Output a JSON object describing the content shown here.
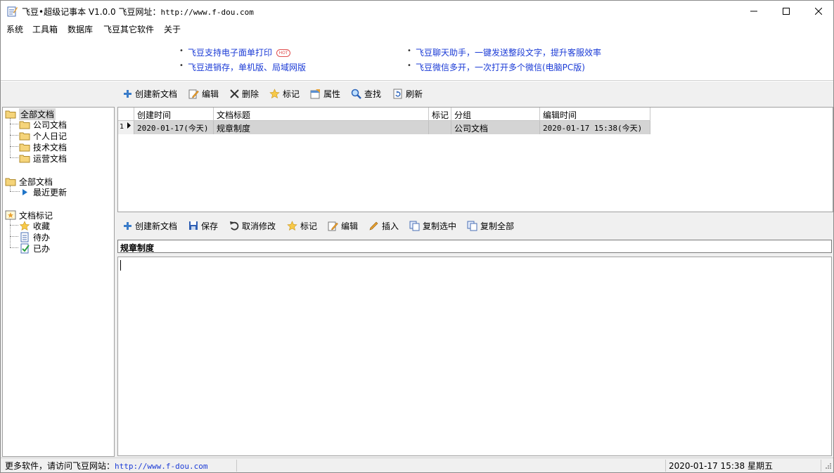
{
  "window": {
    "title": "飞豆•超级记事本 V1.0.0  飞豆网址：",
    "title_url": "http://www.f-dou.com"
  },
  "menu": [
    "系统",
    "工具箱",
    "数据库",
    "飞豆其它软件",
    "关于"
  ],
  "promo": {
    "links": [
      "飞豆支持电子面单打印",
      "飞豆进销存，单机版、局域网版",
      "飞豆聊天助手，一键发送整段文字，提升客服效率",
      "飞豆微信多开，一次打开多个微信(电脑PC版)"
    ],
    "hot_badge": "HOT",
    "bullet": "•"
  },
  "top_toolbar": [
    "创建新文档",
    "编辑",
    "删除",
    "标记",
    "属性",
    "查找",
    "刷新"
  ],
  "tree": {
    "group1": {
      "label": "全部文档",
      "children": [
        "公司文档",
        "个人日记",
        "技术文档",
        "运营文档"
      ]
    },
    "group2": {
      "label": "全部文档",
      "children": [
        "最近更新"
      ]
    },
    "group3": {
      "label": "文档标记",
      "children": [
        "收藏",
        "待办",
        "已办"
      ]
    }
  },
  "grid": {
    "columns": [
      "创建时间",
      "文档标题",
      "标记",
      "分组",
      "编辑时间"
    ],
    "rows": [
      {
        "num": "1",
        "created": "2020-01-17(今天)",
        "title": "规章制度",
        "mark": "",
        "group": "公司文档",
        "edited": "2020-01-17 15:38(今天)"
      }
    ]
  },
  "editor_toolbar": [
    "创建新文档",
    "保存",
    "取消修改",
    "标记",
    "编辑",
    "插入",
    "复制选中",
    "复制全部"
  ],
  "document": {
    "title": "规章制度",
    "body": ""
  },
  "status": {
    "left_text": "更多软件，请访问飞豆网站：",
    "left_url": "http://www.f-dou.com",
    "datetime": "2020-01-17 15:38 星期五"
  },
  "colors": {
    "link": "#1b3bd6",
    "hot": "#e05050",
    "folder": "#f5d47a",
    "selected_row": "#d4d4d4"
  }
}
